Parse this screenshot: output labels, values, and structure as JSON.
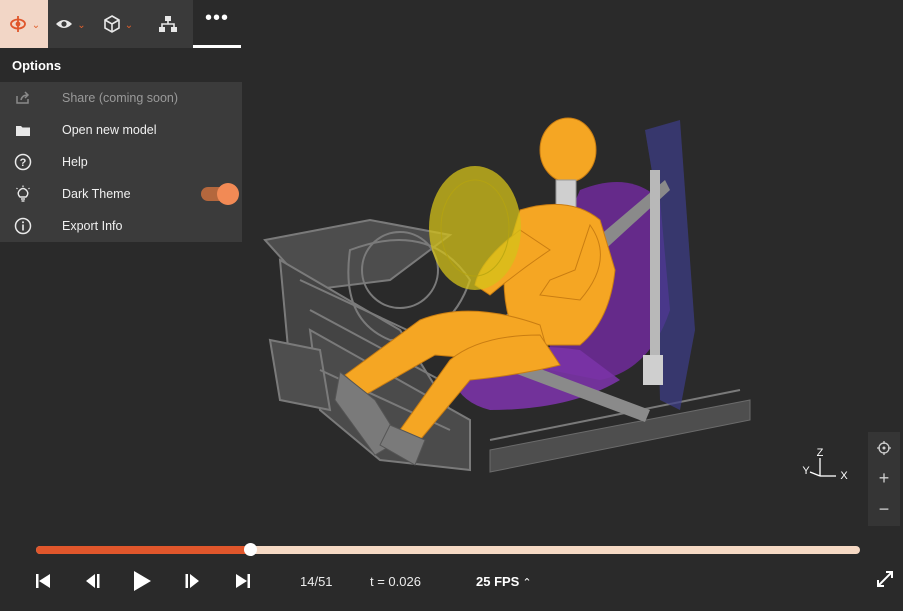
{
  "toolbar": {
    "buttons": [
      {
        "name": "model-menu",
        "icon": "model-axes-icon",
        "has_dropdown": true,
        "active": true
      },
      {
        "name": "visibility-menu",
        "icon": "eye-icon",
        "has_dropdown": true
      },
      {
        "name": "view-menu",
        "icon": "cube-icon",
        "has_dropdown": true
      },
      {
        "name": "tree",
        "icon": "hierarchy-icon",
        "has_dropdown": false
      }
    ],
    "more_label": "•••"
  },
  "options": {
    "title": "Options",
    "items": [
      {
        "label": "Share (coming soon)",
        "icon": "share-icon",
        "disabled": true
      },
      {
        "label": "Open new model",
        "icon": "folder-icon"
      },
      {
        "label": "Help",
        "icon": "help-icon"
      },
      {
        "label": "Dark Theme",
        "icon": "lightbulb-icon",
        "toggle": true,
        "toggle_on": true
      },
      {
        "label": "Export Info",
        "icon": "info-icon"
      }
    ]
  },
  "axis": {
    "z": "Z",
    "y": "Y",
    "x": "X"
  },
  "view_controls": {
    "center": "crosshair-icon",
    "zoom_in": "+",
    "zoom_out": "−"
  },
  "playback": {
    "frame": "14/51",
    "time": "t = 0.026",
    "fps": "25 FPS",
    "progress": 0.26
  },
  "colors": {
    "accent": "#e0562b",
    "dummy": "#f5a623",
    "seat": "#7a2ea0",
    "airbag": "#d4c21a",
    "background": "#2a2a2a"
  }
}
